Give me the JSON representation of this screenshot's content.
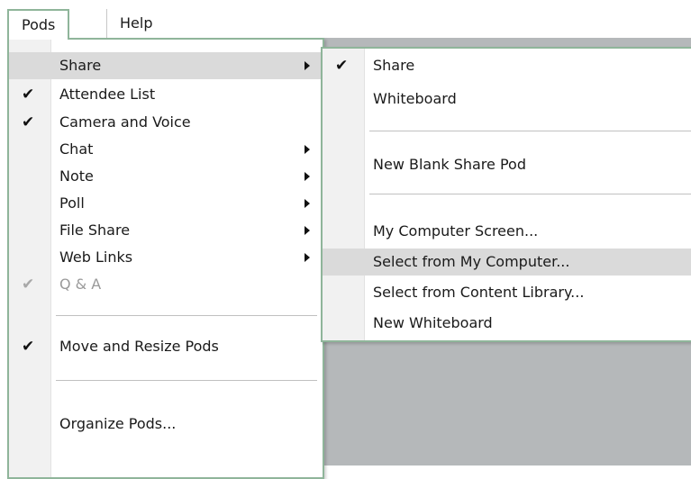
{
  "menubar": {
    "items": [
      {
        "label": "Pods"
      },
      {
        "label": "Help"
      }
    ]
  },
  "pods_menu": {
    "items": [
      {
        "label": "Share",
        "checked": false,
        "submenu": true,
        "highlighted": true
      },
      {
        "label": "Attendee List",
        "checked": true,
        "submenu": false
      },
      {
        "label": "Camera and Voice",
        "checked": true,
        "submenu": false
      },
      {
        "label": "Chat",
        "checked": false,
        "submenu": true
      },
      {
        "label": "Note",
        "checked": false,
        "submenu": true
      },
      {
        "label": "Poll",
        "checked": false,
        "submenu": true
      },
      {
        "label": "File Share",
        "checked": false,
        "submenu": true
      },
      {
        "label": "Web Links",
        "checked": false,
        "submenu": true
      },
      {
        "label": "Q & A",
        "checked": true,
        "submenu": false,
        "disabled": true
      },
      {
        "label": "Move and Resize Pods",
        "checked": true,
        "submenu": false
      },
      {
        "label": "Organize Pods...",
        "checked": false,
        "submenu": false
      }
    ]
  },
  "share_submenu": {
    "items": [
      {
        "label": "Share",
        "checked": true
      },
      {
        "label": "Whiteboard",
        "checked": false
      },
      {
        "label": "New Blank Share Pod",
        "checked": false
      },
      {
        "label": "My Computer Screen...",
        "checked": false
      },
      {
        "label": "Select from My Computer...",
        "checked": false,
        "highlighted": true
      },
      {
        "label": "Select from Content Library...",
        "checked": false
      },
      {
        "label": "New Whiteboard",
        "checked": false
      }
    ]
  },
  "icons": {
    "check": "checkmark-icon",
    "submenu": "submenu-arrow-icon"
  },
  "colors": {
    "menu_border": "#8fb59a",
    "highlight": "#dadada",
    "gutter": "#f1f1f1",
    "app_background": "#b5b8ba"
  }
}
